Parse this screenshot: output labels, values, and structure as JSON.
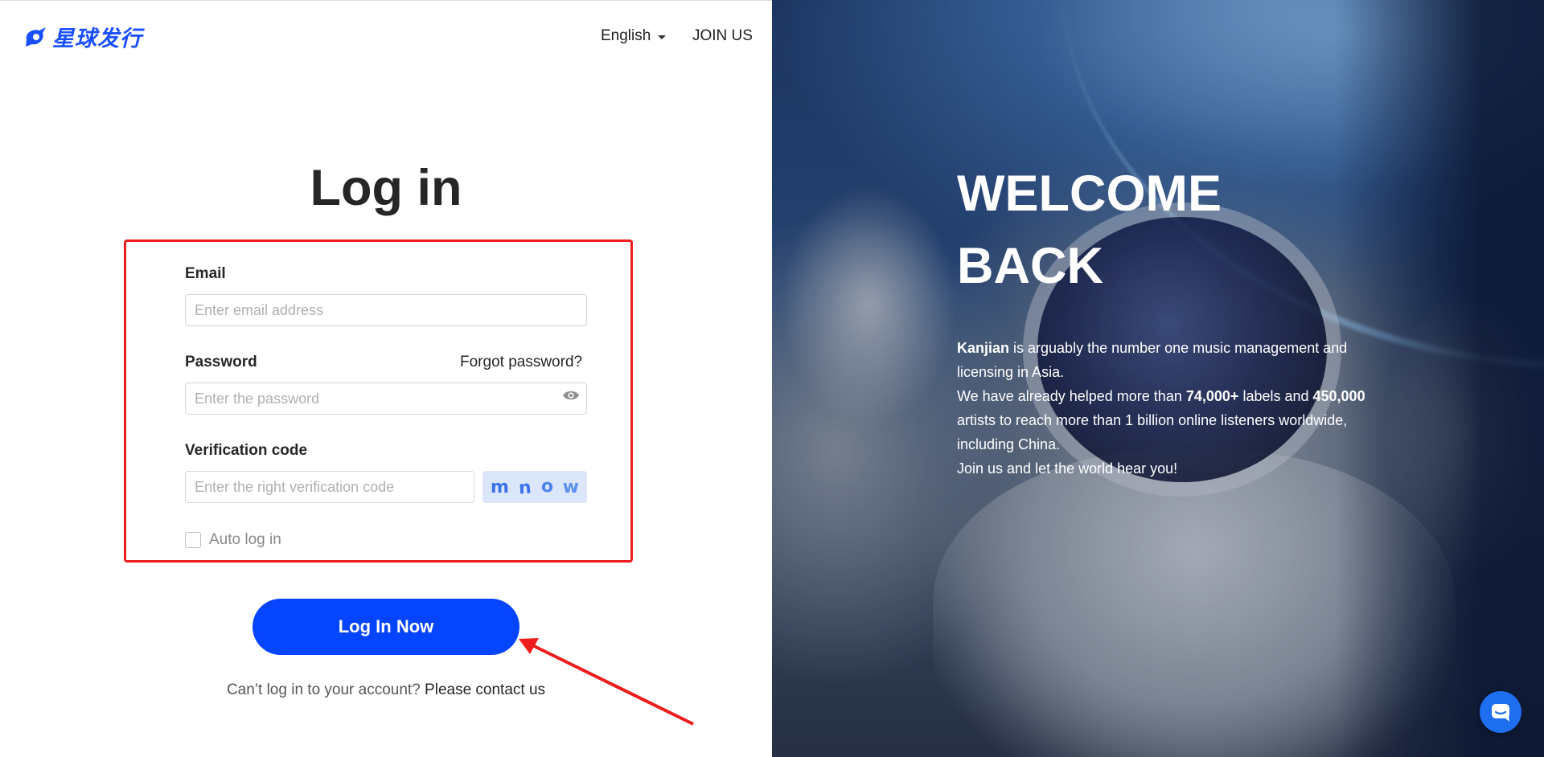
{
  "header": {
    "logo_text": "星球发行",
    "language_label": "English",
    "join_label": "JOIN US"
  },
  "login": {
    "title": "Log in",
    "email_label": "Email",
    "email_placeholder": "Enter email address",
    "password_label": "Password",
    "forgot_label": "Forgot password?",
    "password_placeholder": "Enter the password",
    "verification_label": "Verification code",
    "verification_placeholder": "Enter the right verification code",
    "captcha_chars": [
      "m",
      "n",
      "o",
      "w"
    ],
    "auto_login_label": "Auto log in",
    "submit_label": "Log In Now",
    "cant_login_text": "Can’t log in to your account?",
    "contact_label": "Please contact us"
  },
  "hero": {
    "welcome_line1": "WELCOME",
    "welcome_line2": "BACK",
    "brand": "Kanjian",
    "line1_rest": " is arguably the number one music management and licensing in Asia.",
    "line2_prefix": "We have already helped more than ",
    "labels_count": "74,000+",
    "line2_mid": " labels and ",
    "artists_count": "450,000",
    "line2_rest": " artists to reach more than 1 billion online listeners worldwide, including China.",
    "line3": "Join us and let the world hear you!"
  },
  "colors": {
    "brand_blue": "#0545ff",
    "logo_blue": "#1a4fff",
    "highlight_red": "#ee1d1d",
    "captcha_bg": "#dce6fb"
  },
  "icons": {
    "logo": "planet-logo-icon",
    "language_caret": "caret-down-icon",
    "password_toggle": "eye-icon",
    "annotation": "red-arrow-icon",
    "chat": "chat-bubble-icon"
  }
}
